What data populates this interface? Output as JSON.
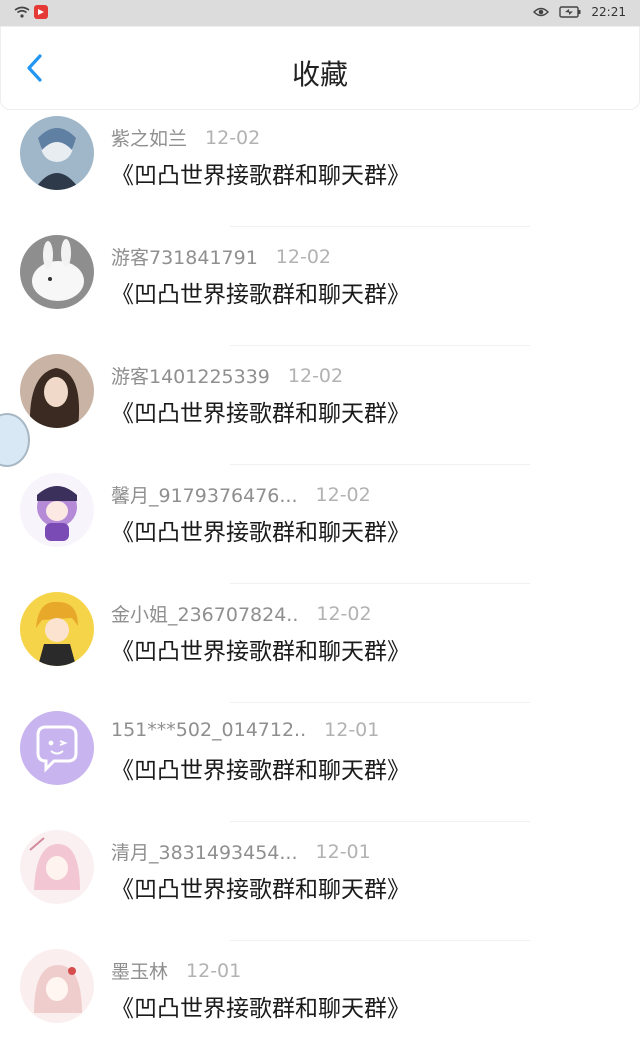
{
  "status_bar": {
    "time": "22:21"
  },
  "header": {
    "title": "收藏",
    "back_icon": "chevron-left-icon"
  },
  "items": [
    {
      "name": "紫之如兰",
      "date": "12-02",
      "title": "《凹凸世界接歌群和聊天群》"
    },
    {
      "name": "游客731841791",
      "date": "12-02",
      "title": "《凹凸世界接歌群和聊天群》"
    },
    {
      "name": "游客1401225339",
      "date": "12-02",
      "title": "《凹凸世界接歌群和聊天群》"
    },
    {
      "name": "馨月_9179376476...",
      "date": "12-02",
      "title": "《凹凸世界接歌群和聊天群》"
    },
    {
      "name": "金小姐_236707824..",
      "date": "12-02",
      "title": "《凹凸世界接歌群和聊天群》"
    },
    {
      "name": "151***502_014712..",
      "date": "12-01",
      "title": "《凹凸世界接歌群和聊天群》"
    },
    {
      "name": "清月_3831493454...",
      "date": "12-01",
      "title": "《凹凸世界接歌群和聊天群》"
    },
    {
      "name": "墨玉林",
      "date": "12-01",
      "title": "《凹凸世界接歌群和聊天群》"
    }
  ],
  "colors": {
    "accent": "#2196f3"
  }
}
